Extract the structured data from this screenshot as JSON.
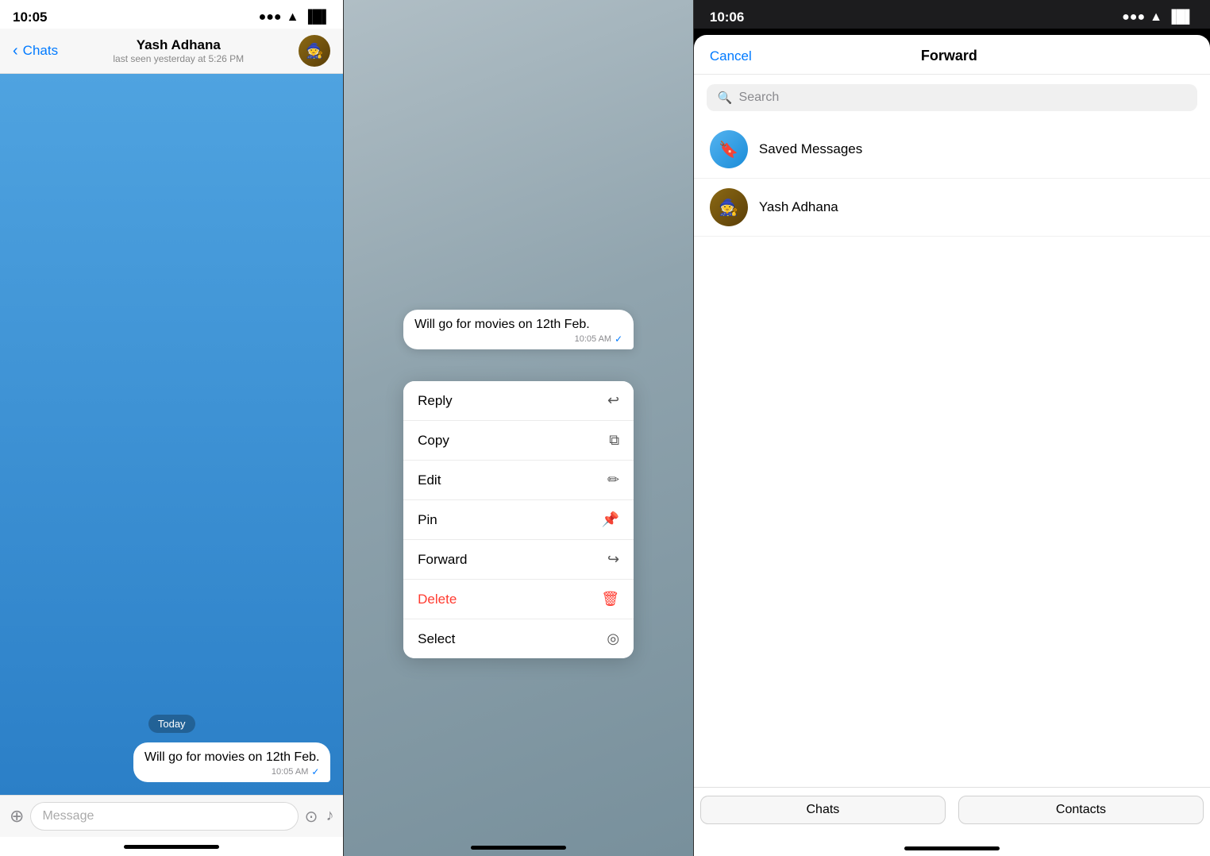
{
  "panel1": {
    "statusBar": {
      "time": "10:05",
      "icons": [
        "signal",
        "wifi",
        "battery"
      ]
    },
    "header": {
      "backLabel": "Chats",
      "contactName": "Yash Adhana",
      "statusText": "last seen yesterday at 5:26 PM"
    },
    "chat": {
      "dateBadge": "Today",
      "messageText": "Will go for movies on 12th Feb.",
      "messageTime": "10:05 AM",
      "checkMark": "✓"
    },
    "inputBar": {
      "placeholder": "Message"
    }
  },
  "panel2": {
    "messageText": "Will go for movies on 12th Feb.",
    "messageTime": "10:05 AM",
    "contextMenu": {
      "items": [
        {
          "label": "Reply",
          "icon": "↩",
          "isDelete": false
        },
        {
          "label": "Copy",
          "icon": "⧉",
          "isDelete": false
        },
        {
          "label": "Edit",
          "icon": "✏",
          "isDelete": false
        },
        {
          "label": "Pin",
          "icon": "📌",
          "isDelete": false
        },
        {
          "label": "Forward",
          "icon": "↪",
          "isDelete": false
        },
        {
          "label": "Delete",
          "icon": "🗑",
          "isDelete": true
        },
        {
          "label": "Select",
          "icon": "◎",
          "isDelete": false
        }
      ]
    }
  },
  "panel3": {
    "statusBar": {
      "time": "10:06",
      "icons": [
        "signal",
        "wifi",
        "battery"
      ]
    },
    "header": {
      "cancelLabel": "Cancel",
      "title": "Forward"
    },
    "search": {
      "placeholder": "Search"
    },
    "contacts": [
      {
        "name": "Saved Messages",
        "type": "saved"
      },
      {
        "name": "Yash Adhana",
        "type": "contact"
      }
    ],
    "tabs": [
      {
        "label": "Chats"
      },
      {
        "label": "Contacts"
      }
    ]
  }
}
